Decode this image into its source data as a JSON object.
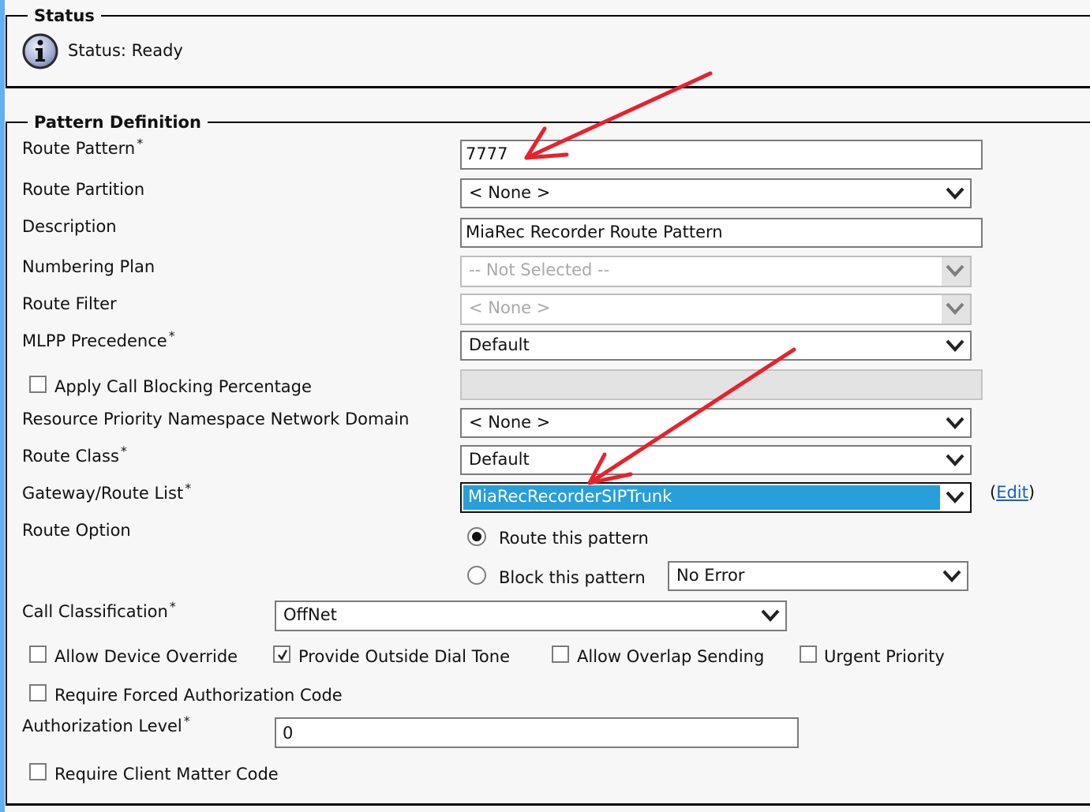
{
  "status": {
    "legend": "Status",
    "icon": "info-icon",
    "text": "Status: Ready"
  },
  "pattern": {
    "legend": "Pattern Definition",
    "route_pattern": {
      "label": "Route Pattern",
      "required": "*",
      "value": "7777"
    },
    "route_partition": {
      "label": "Route Partition",
      "value": "< None >"
    },
    "description": {
      "label": "Description",
      "value": "MiaRec Recorder Route Pattern"
    },
    "numbering_plan": {
      "label": "Numbering Plan",
      "value": "-- Not Selected --",
      "disabled": true
    },
    "route_filter": {
      "label": "Route Filter",
      "value": "< None >",
      "disabled": true
    },
    "mlpp_precedence": {
      "label": "MLPP Precedence",
      "required": "*",
      "value": "Default"
    },
    "apply_call_blocking": {
      "label": "Apply Call Blocking Percentage",
      "checked": false,
      "value": ""
    },
    "resource_priority": {
      "label": "Resource Priority Namespace Network Domain",
      "value": "< None >"
    },
    "route_class": {
      "label": "Route Class",
      "required": "*",
      "value": "Default"
    },
    "gateway_route_list": {
      "label": "Gateway/Route List",
      "required": "*",
      "value": "MiaRecRecorderSIPTrunk",
      "edit_open": "(",
      "edit_label": "Edit",
      "edit_close": ")"
    },
    "route_option": {
      "label": "Route Option",
      "options": [
        {
          "label": "Route this pattern",
          "selected": true
        },
        {
          "label": "Block this pattern",
          "selected": false
        }
      ],
      "block_reason": "No Error"
    },
    "call_classification": {
      "label": "Call Classification",
      "required": "*",
      "value": "OffNet"
    },
    "checkboxes_row": [
      {
        "label": "Allow Device Override",
        "checked": false
      },
      {
        "label": "Provide Outside Dial Tone",
        "checked": true
      },
      {
        "label": "Allow Overlap Sending",
        "checked": false
      },
      {
        "label": "Urgent Priority",
        "checked": false
      }
    ],
    "require_forced_auth": {
      "label": "Require Forced Authorization Code",
      "checked": false
    },
    "authorization_level": {
      "label": "Authorization Level",
      "required": "*",
      "value": "0"
    },
    "require_client_matter": {
      "label": "Require Client Matter Code",
      "checked": false
    }
  },
  "annotations": {
    "arrow_color": "#e8212b"
  }
}
